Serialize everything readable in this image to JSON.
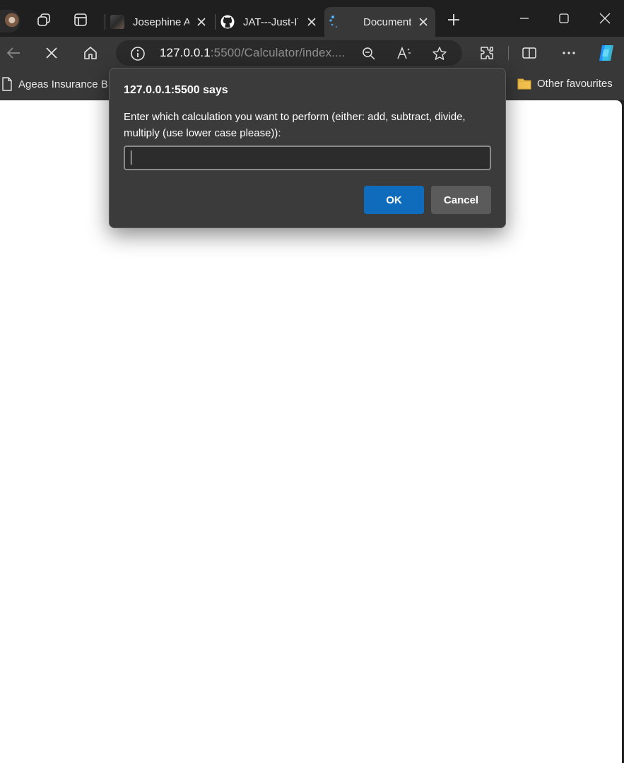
{
  "browser": {
    "tabs": [
      {
        "title": "Josephine A",
        "favicon": "profile-photo-icon",
        "active": false
      },
      {
        "title": "JAT---Just-IT",
        "favicon": "github-icon",
        "active": false
      },
      {
        "title": "Document",
        "favicon": "loading-spinner-icon",
        "active": true
      }
    ],
    "address": {
      "host": "127.0.0.1",
      "rest": ":5500/Calculator/index...."
    },
    "favourites": [
      {
        "label": "Ageas Insurance Br...",
        "icon": "document-icon"
      },
      {
        "label": "Other favourites",
        "icon": "folder-icon"
      }
    ]
  },
  "dialog": {
    "title": "127.0.0.1:5500 says",
    "message": "Enter which calculation you want to perform (either: add, subtract, divide, multiply (use lower case please)):",
    "input_value": "",
    "ok_label": "OK",
    "cancel_label": "Cancel"
  },
  "colors": {
    "accent": "#0f6cbd",
    "dialog_bg": "#3b3b3b",
    "chrome_bg": "#383838",
    "tabstrip_bg": "#1f1f1f"
  }
}
